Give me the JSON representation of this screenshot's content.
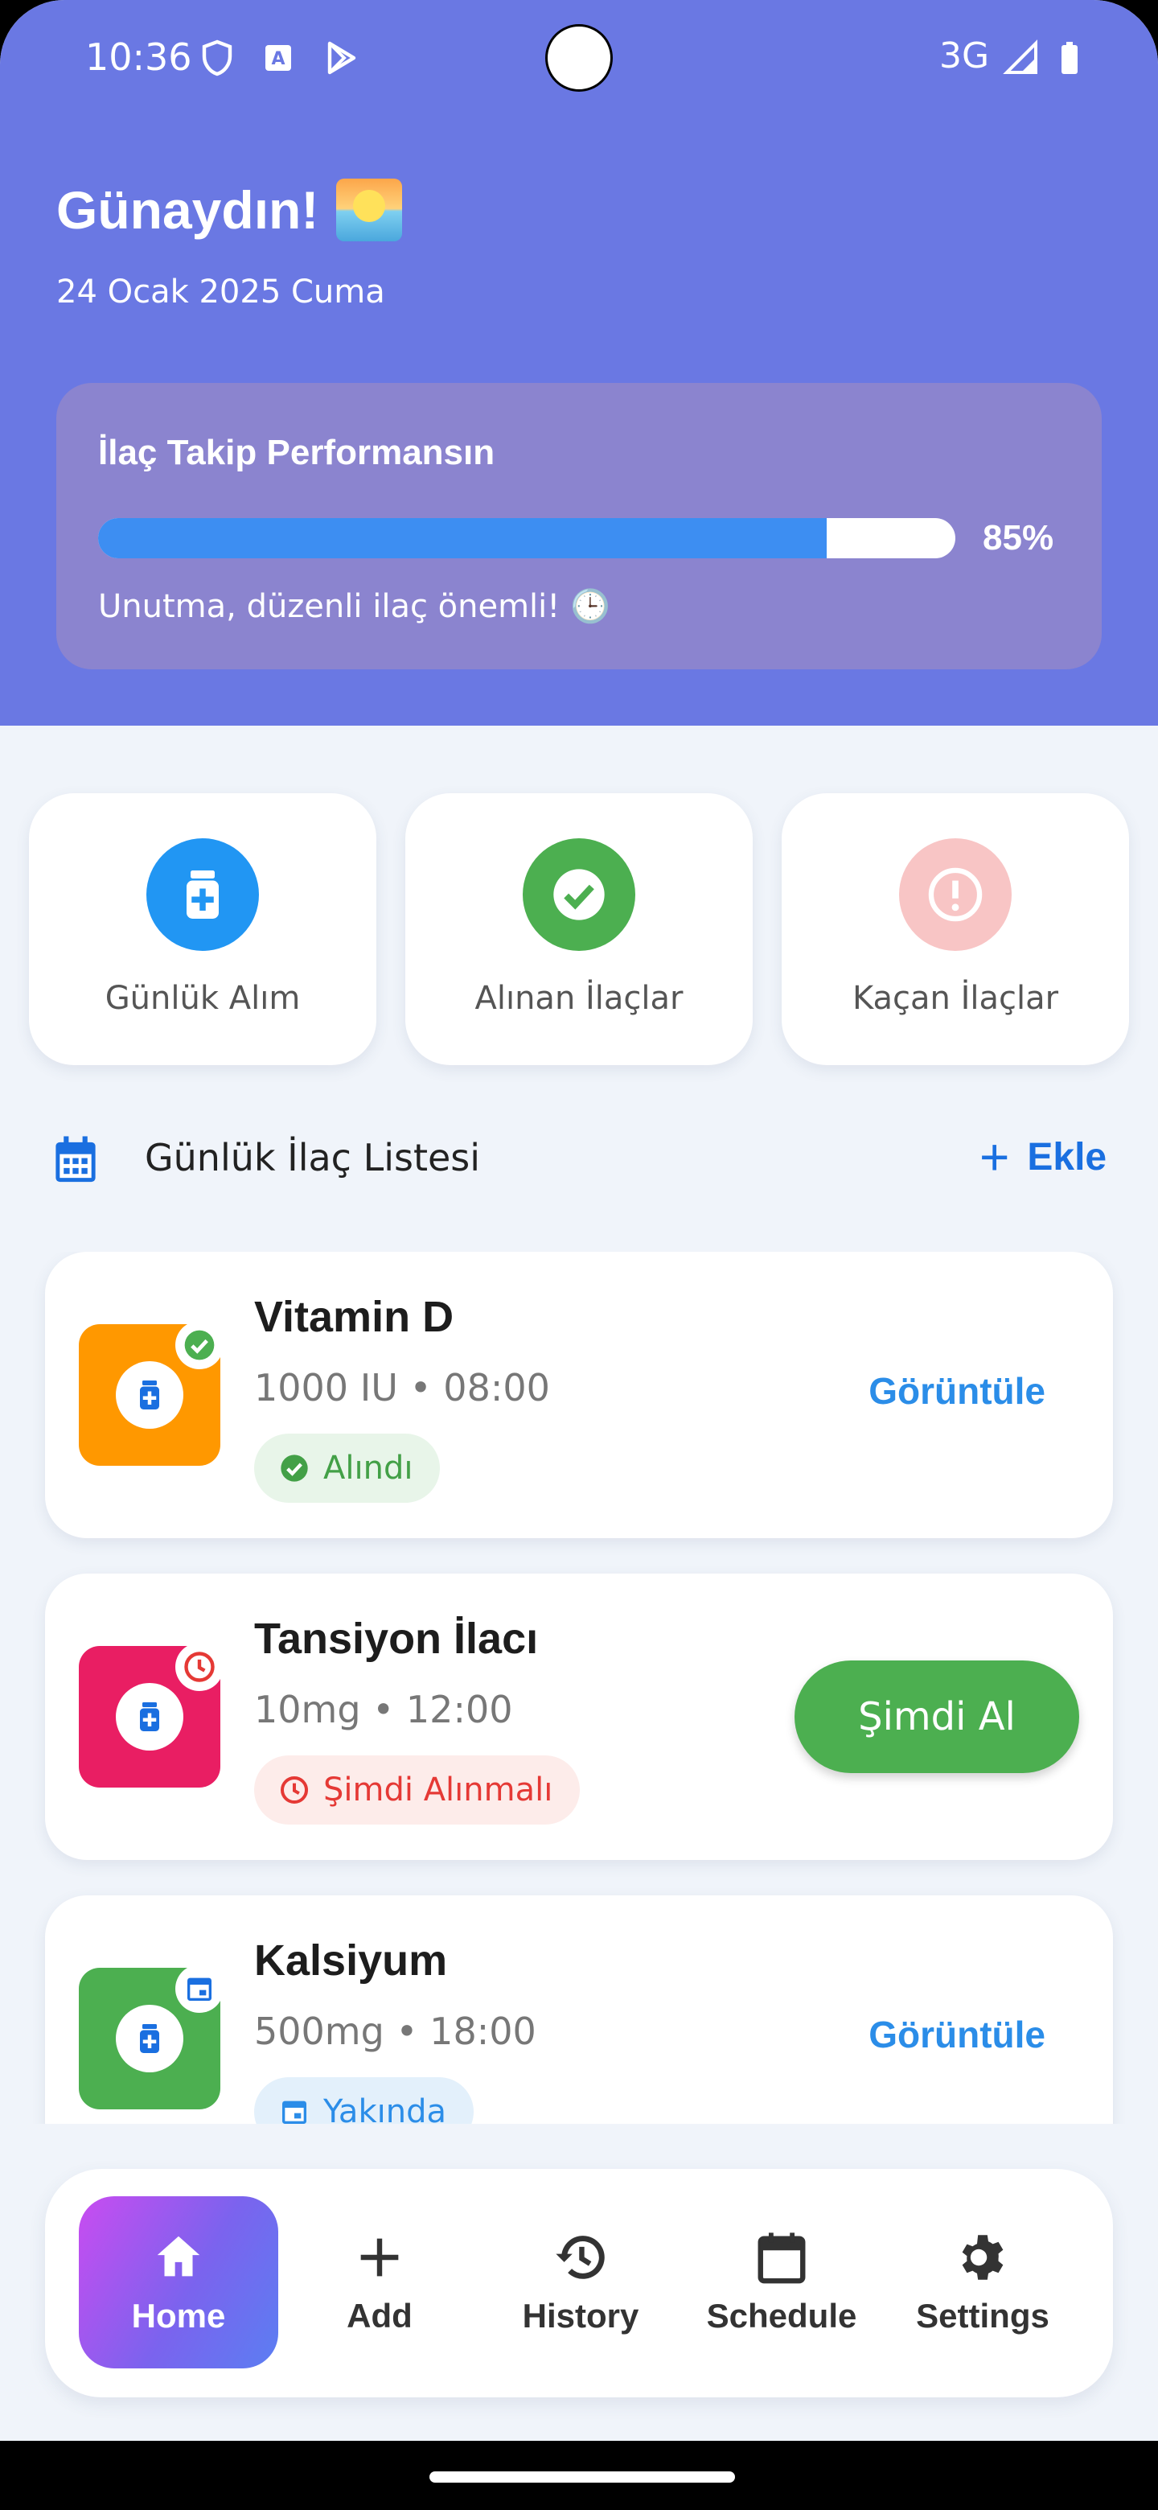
{
  "status_bar": {
    "time": "10:36",
    "network": "3G"
  },
  "header": {
    "greeting": "Günaydın!",
    "date": "24 Ocak 2025 Cuma"
  },
  "performance": {
    "title": "İlaç Takip Performansın",
    "progress_percent": 85,
    "progress_label": "85%",
    "note": "Unutma, düzenli ilaç önemli! 🕒"
  },
  "stats": [
    {
      "label": "Günlük Alım",
      "icon": "pill-bottle-icon",
      "color": "#2196f3"
    },
    {
      "label": "Alınan İlaçlar",
      "icon": "check-circle-icon",
      "color": "#4caf50"
    },
    {
      "label": "Kaçan İlaçlar",
      "icon": "warning-icon",
      "color": "#f8c5c5"
    }
  ],
  "list": {
    "title": "Günlük İlaç Listesi",
    "add_label": "Ekle"
  },
  "medications": [
    {
      "name": "Vitamin D",
      "dose": "1000 IU • 08:00",
      "status": "Alındı",
      "action": "Görüntüle",
      "color": "#ff9800",
      "badge": "check-icon"
    },
    {
      "name": "Tansiyon İlacı",
      "dose": "10mg • 12:00",
      "status": "Şimdi Alınmalı",
      "action": "Şimdi Al",
      "color": "#e91e63",
      "badge": "clock-icon"
    },
    {
      "name": "Kalsiyum",
      "dose": "500mg • 18:00",
      "status": "Yakında",
      "action": "Görüntüle",
      "color": "#4caf50",
      "badge": "calendar-icon"
    }
  ],
  "nav": [
    {
      "label": "Home",
      "icon": "home-icon",
      "active": true
    },
    {
      "label": "Add",
      "icon": "plus-icon"
    },
    {
      "label": "History",
      "icon": "history-icon"
    },
    {
      "label": "Schedule",
      "icon": "calendar-icon"
    },
    {
      "label": "Settings",
      "icon": "gear-icon"
    }
  ]
}
